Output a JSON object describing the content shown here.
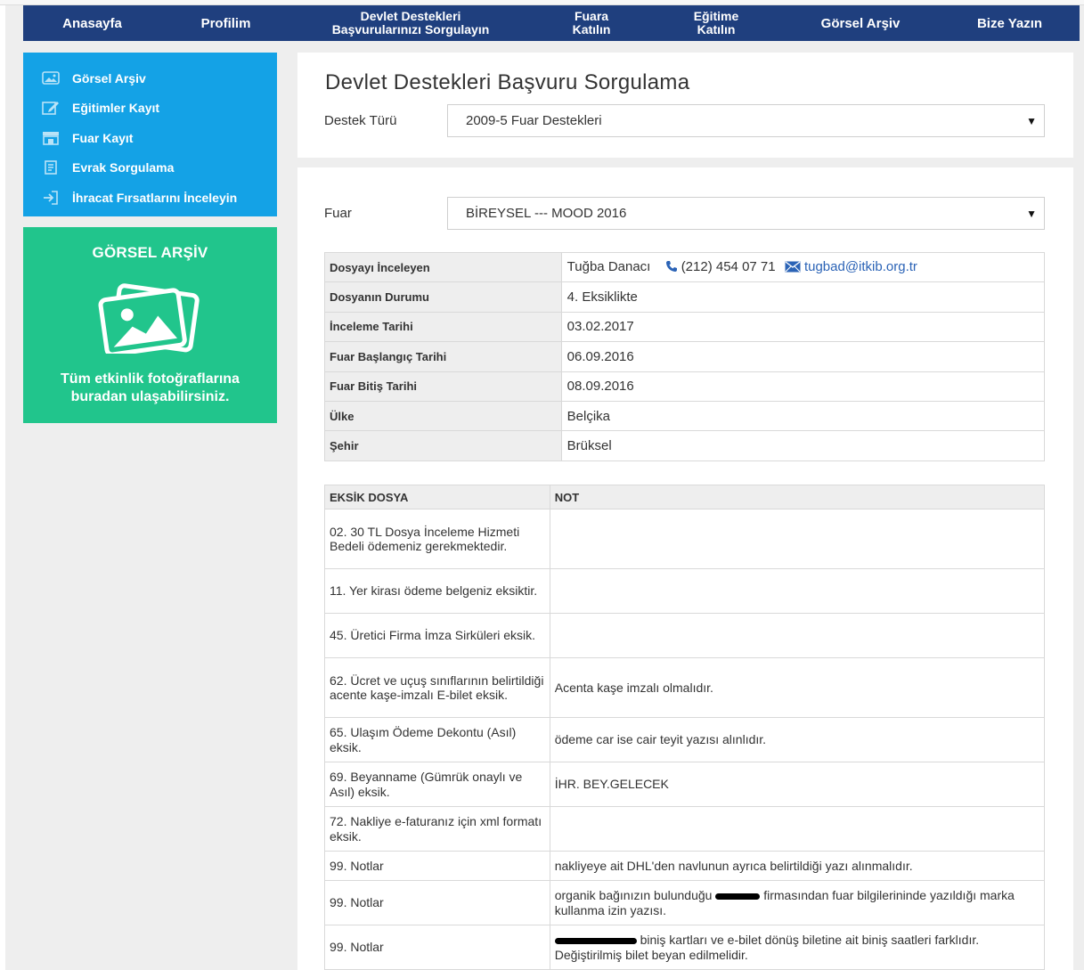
{
  "nav": {
    "items": [
      {
        "label": "Anasayfa"
      },
      {
        "label": "Profilim"
      },
      {
        "label_line1": "Devlet Destekleri",
        "label_line2": "Başvurularınızı Sorgulayın"
      },
      {
        "label_line1": "Fuara",
        "label_line2": "Katılın"
      },
      {
        "label_line1": "Eğitime",
        "label_line2": "Katılın"
      },
      {
        "label": "Görsel Arşiv"
      },
      {
        "label": "Bize Yazın"
      }
    ]
  },
  "sidebar": {
    "items": [
      {
        "label": "Görsel Arşiv",
        "icon": "photo-icon"
      },
      {
        "label": "Eğitimler Kayıt",
        "icon": "edit-icon"
      },
      {
        "label": "Fuar Kayıt",
        "icon": "store-icon"
      },
      {
        "label": "Evrak Sorgulama",
        "icon": "document-icon"
      },
      {
        "label": "İhracat Fırsatlarını İnceleyin",
        "icon": "sign-in-icon"
      }
    ],
    "card": {
      "title": "GÖRSEL ARŞİV",
      "text_line1": "Tüm etkinlik fotoğraflarına",
      "text_line2": "buradan ulaşabilirsiniz."
    }
  },
  "page": {
    "title": "Devlet Destekleri Başvuru Sorgulama",
    "destek_label": "Destek Türü",
    "destek_value": "2009-5 Fuar Destekleri",
    "fuar_label": "Fuar",
    "fuar_value": "BİREYSEL --- MOOD 2016"
  },
  "info": {
    "rows": [
      {
        "key": "Dosyayı İnceleyen",
        "value": "Tuğba Danacı"
      },
      {
        "key": "Dosyanın Durumu",
        "value": "4. Eksiklikte"
      },
      {
        "key": "İnceleme Tarihi",
        "value": "03.02.2017"
      },
      {
        "key": "Fuar Başlangıç Tarihi",
        "value": "06.09.2016"
      },
      {
        "key": "Fuar Bitiş Tarihi",
        "value": "08.09.2016"
      },
      {
        "key": "Ülke",
        "value": "Belçika"
      },
      {
        "key": "Şehir",
        "value": "Brüksel"
      }
    ],
    "phone": "(212) 454 07 71",
    "email": "tugbad@itkib.org.tr"
  },
  "docs": {
    "headers": [
      "EKSİK DOSYA",
      "NOT"
    ],
    "rows": [
      {
        "doc": "02. 30 TL Dosya İnceleme Hizmeti Bedeli ödemeniz gerekmektedir.",
        "note": ""
      },
      {
        "doc": "11. Yer kirası ödeme belgeniz eksiktir.",
        "note": ""
      },
      {
        "doc": "45. Üretici Firma İmza Sirküleri eksik.",
        "note": ""
      },
      {
        "doc": "62. Ücret ve uçuş sınıflarının belirtildiği acente kaşe-imzalı E-bilet eksik.",
        "note": "Acenta kaşe imzalı olmalıdır."
      },
      {
        "doc": "65. Ulaşım Ödeme Dekontu (Asıl) eksik.",
        "note": "ödeme car ise cair teyit yazısı alınlıdır."
      },
      {
        "doc": "69. Beyanname (Gümrük onaylı ve Asıl) eksik.",
        "note": "İHR. BEY.GELECEK"
      },
      {
        "doc": "72. Nakliye e-faturanız için xml formatı eksik.",
        "note": ""
      },
      {
        "doc": "99. Notlar",
        "note": "nakliyeye ait DHL'den navlunun ayrıca belirtildiği yazı alınmalıdır."
      },
      {
        "doc": "99. Notlar",
        "note_a": "organik bağınızın bulunduğu",
        "note_b": "firmasından fuar bilgilerininde yazıldığı marka kullanma izin yazısı."
      },
      {
        "doc": "99. Notlar",
        "note_b": "biniş kartları ve e-bilet dönüş biletine ait biniş saatleri farklıdır. Değiştirilmiş bilet beyan edilmelidir."
      }
    ]
  },
  "colors": {
    "navbar": "#1f3f7e",
    "sidebar": "#14a2e6",
    "card": "#21c58c",
    "link": "#2b63b6"
  }
}
